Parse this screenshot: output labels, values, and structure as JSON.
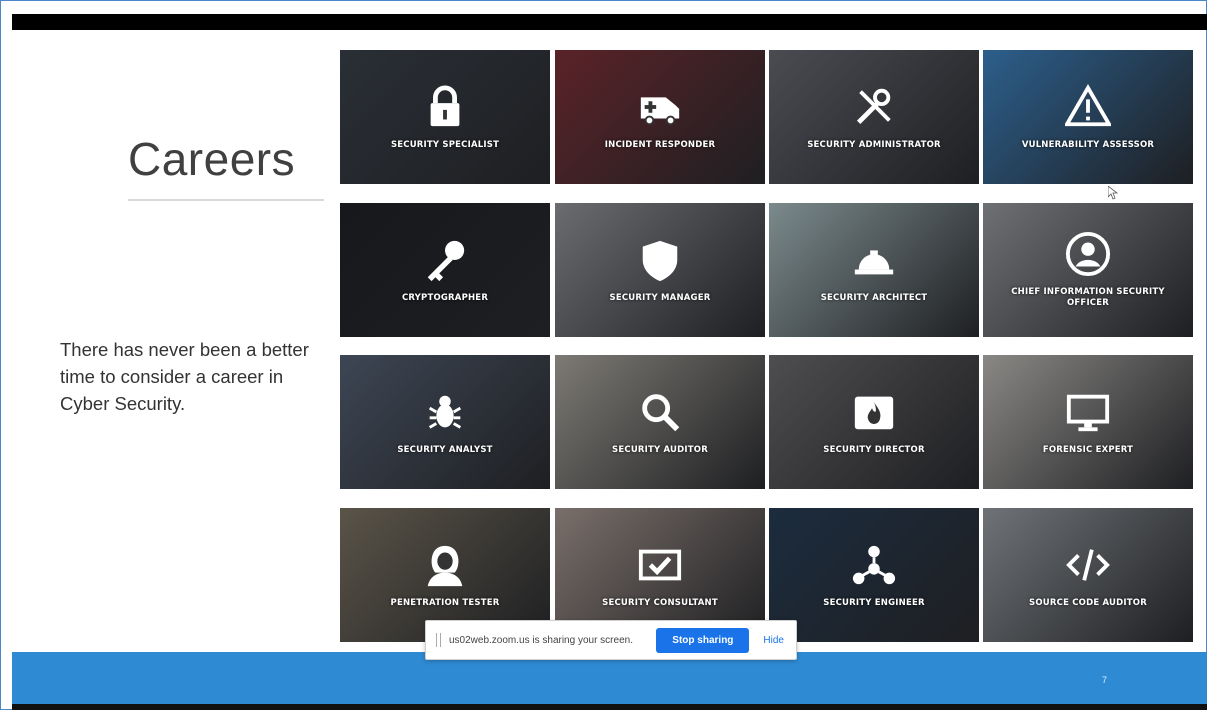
{
  "slide": {
    "title": "Careers",
    "body": "There has never been a better time to consider a career in Cyber Security.",
    "page_number": "7"
  },
  "tiles": [
    {
      "label": "SECURITY SPECIALIST",
      "icon": "padlock-icon",
      "bg": "#2a2f36"
    },
    {
      "label": "INCIDENT RESPONDER",
      "icon": "ambulance-icon",
      "bg": "#5a2328"
    },
    {
      "label": "SECURITY ADMINISTRATOR",
      "icon": "tools-icon",
      "bg": "#4a4c52"
    },
    {
      "label": "VULNERABILITY ASSESSOR",
      "icon": "warning-icon",
      "bg": "#2c5f8c"
    },
    {
      "label": "CRYPTOGRAPHER",
      "icon": "key-icon",
      "bg": "#16181c"
    },
    {
      "label": "SECURITY MANAGER",
      "icon": "shield-icon",
      "bg": "#6a6c70"
    },
    {
      "label": "SECURITY ARCHITECT",
      "icon": "hardhat-icon",
      "bg": "#7b8a8c"
    },
    {
      "label": "CHIEF INFORMATION SECURITY OFFICER",
      "icon": "user-icon",
      "bg": "#6e7073"
    },
    {
      "label": "SECURITY ANALYST",
      "icon": "bug-icon",
      "bg": "#3d4654"
    },
    {
      "label": "SECURITY AUDITOR",
      "icon": "magnifier-icon",
      "bg": "#7d7a74"
    },
    {
      "label": "SECURITY DIRECTOR",
      "icon": "fire-icon",
      "bg": "#4e4d4f"
    },
    {
      "label": "FORENSIC EXPERT",
      "icon": "monitor-icon",
      "bg": "#8a8885"
    },
    {
      "label": "PENETRATION TESTER",
      "icon": "hacker-icon",
      "bg": "#5a5448"
    },
    {
      "label": "SECURITY CONSULTANT",
      "icon": "checkbox-icon",
      "bg": "#7a6f6a"
    },
    {
      "label": "SECURITY ENGINEER",
      "icon": "network-icon",
      "bg": "#1c2c3e"
    },
    {
      "label": "SOURCE CODE AUDITOR",
      "icon": "code-icon",
      "bg": "#6f7377"
    }
  ],
  "share_bar": {
    "message": "us02web.zoom.us is sharing your screen.",
    "stop_label": "Stop sharing",
    "hide_label": "Hide"
  },
  "colors": {
    "accent_blue": "#2e8ad3",
    "stop_button": "#1a73e8"
  }
}
